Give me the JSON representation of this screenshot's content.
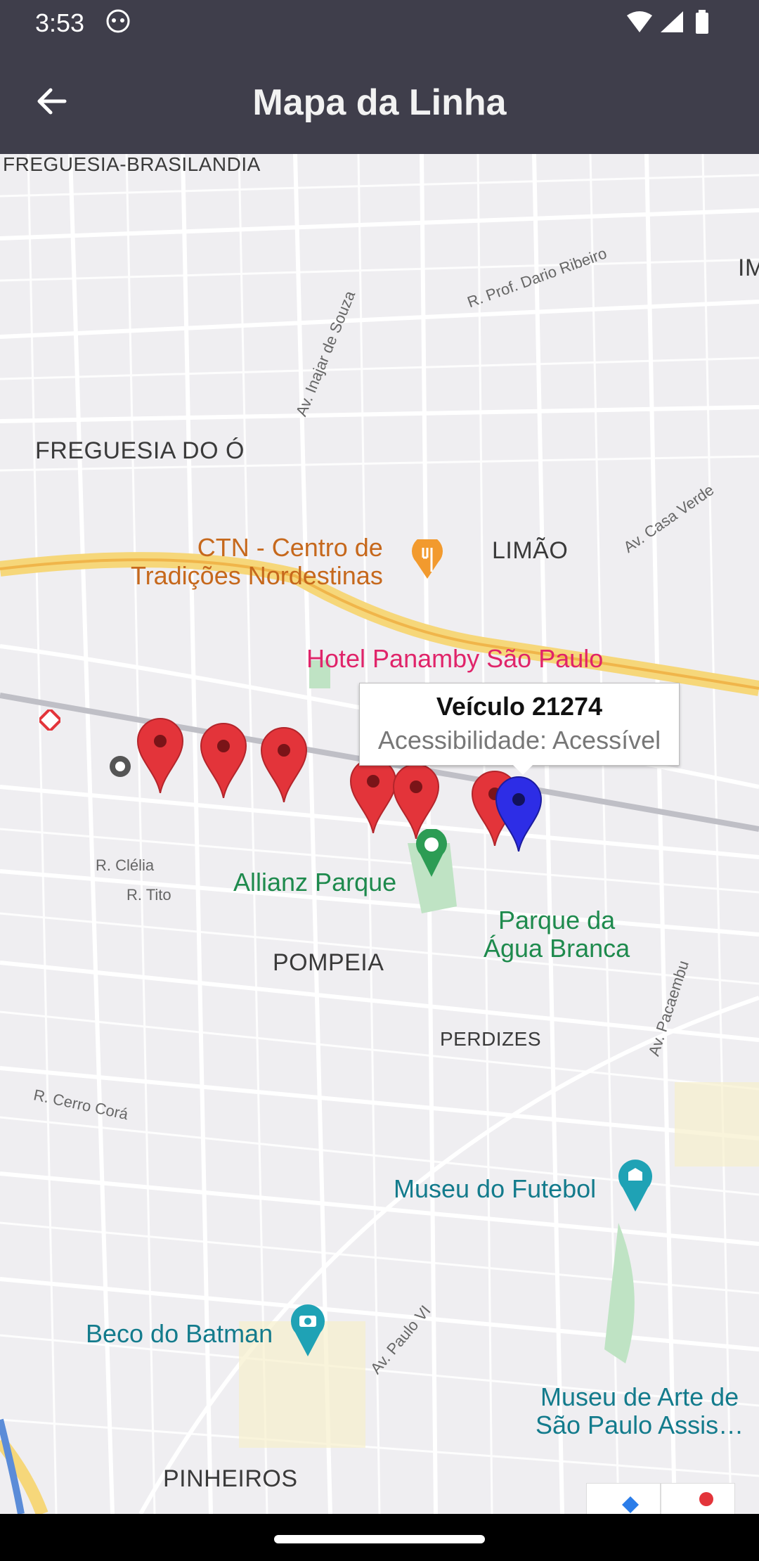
{
  "status_bar": {
    "time": "3:53"
  },
  "app_bar": {
    "title": "Mapa da Linha"
  },
  "map": {
    "districts": [
      "FREGUESIA-BRASILANDIA",
      "FREGUESIA DO Ó",
      "LIMÃO",
      "POMPEIA",
      "PERDIZES",
      "PINHEIROS",
      "IM"
    ],
    "streets": [
      "R. Prof. Dario Ribeiro",
      "Av. Inajar de Souza",
      "Av. Casa Verde",
      "R. Clélia",
      "R. Tito",
      "R. Cerro Corá",
      "Av. Pacaembu",
      "Av. Paulo VI"
    ],
    "pois": {
      "ctn": "CTN - Centro de\nTradições Nordestinas",
      "hotel": "Hotel Panamby São Paulo",
      "allianz": "Allianz Parque",
      "parque_agua_branca": "Parque da\nÁgua Branca",
      "museu_futebol": "Museu do Futebol",
      "beco_batman": "Beco do Batman",
      "museu_arte": "Museu de Arte de\nSão Paulo Assis…"
    },
    "info_window": {
      "title": "Veículo 21274",
      "subtitle": "Acessibilidade: Acessível"
    },
    "marker_colors": {
      "stop": "#e3343a",
      "vehicle": "#2d2de6"
    }
  }
}
